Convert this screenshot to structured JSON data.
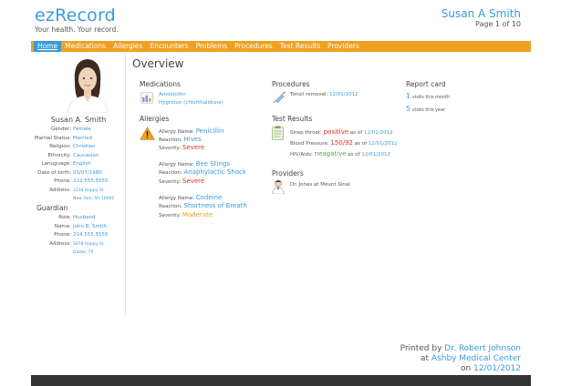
{
  "brand": {
    "name": "ezRecord",
    "tagline": "Your health. Your record."
  },
  "header": {
    "patient_name": "Susan A Smith",
    "page_label": "Page 1 of 10"
  },
  "nav": {
    "items": [
      "Home",
      "Medications",
      "Allergies",
      "Encounters",
      "Problems",
      "Procedures",
      "Test Results",
      "Providers"
    ],
    "active": "Home"
  },
  "sidebar": {
    "name": "Susan A. Smith",
    "demographics": [
      {
        "label": "Gender:",
        "value": "Female"
      },
      {
        "label": "Martial Status:",
        "value": "Married"
      },
      {
        "label": "Religion:",
        "value": "Christian"
      },
      {
        "label": "Ethnicity:",
        "value": "Caucasian"
      },
      {
        "label": "Lanuguage:",
        "value": "English"
      },
      {
        "label": "Date of birth:",
        "value": "03/07/1980"
      },
      {
        "label": "Phone:",
        "value": "212.555.5555"
      },
      {
        "label": "Address:",
        "value": "1234 Happy St"
      },
      {
        "label": "",
        "value": "New York, NY 10001"
      }
    ],
    "guardian_title": "Guardian",
    "guardian": [
      {
        "label": "Role:",
        "value": "Husband"
      },
      {
        "label": "Name:",
        "value": "John B. Smith"
      },
      {
        "label": "Phone:",
        "value": "214.555.5555"
      },
      {
        "label": "Address:",
        "value": "5678 Happy St"
      },
      {
        "label": "",
        "value": "Dallas, TX"
      }
    ]
  },
  "overview": {
    "title": "Overview",
    "medications": {
      "title": "Medications",
      "items": [
        "Amoxicillin",
        "Hygroton (chlorthalidone)"
      ]
    },
    "allergies": {
      "title": "Allergies",
      "name_label": "Allergy Name:",
      "reaction_label": "Reaction:",
      "severity_label": "Severity:",
      "items": [
        {
          "name": "Penicillin",
          "reaction": "Hives",
          "severity": "Severe"
        },
        {
          "name": "Bee Stings",
          "reaction": "Anaphylactic Shock",
          "severity": "Severe"
        },
        {
          "name": "Codeine",
          "reaction": "Shortness of Breath",
          "severity": "Moderate"
        }
      ]
    },
    "procedures": {
      "title": "Procedures",
      "name": "Tonsil removal:",
      "date": "12/01/2012"
    },
    "test_results": {
      "title": "Test Results",
      "as_of": "as of",
      "items": [
        {
          "name": "Strep throat:",
          "result": "positive",
          "date": "12/01/2012"
        },
        {
          "name": "Blood Pressure:",
          "result": "150/92",
          "date": "12/01/2012"
        },
        {
          "name": "HIV/Aids:",
          "result": "neagative",
          "date": "12/01/2012"
        }
      ]
    },
    "providers": {
      "title": "Providers",
      "name": "Dr. Jones at Mount Sinai"
    },
    "report_card": {
      "title": "Report card",
      "month_count": "1",
      "month_label": "visits this month",
      "year_count": "5",
      "year_label": "visits this year"
    }
  },
  "footer": {
    "printed_by": "Printed by",
    "doctor": "Dr. Robert Johnson",
    "at": "at",
    "center": "Ashby Medical Center",
    "on": "on",
    "date": "12/01/2012"
  },
  "colors": {
    "accent": "#3a9ad9",
    "nav": "#f0a020",
    "severe": "#e0301e",
    "moderate": "#f0a020",
    "negative": "#5aaa3a",
    "bar": "#333333"
  },
  "icons": [
    "medication-icon",
    "warning-icon",
    "syringe-icon",
    "clipboard-icon",
    "doctor-icon"
  ]
}
